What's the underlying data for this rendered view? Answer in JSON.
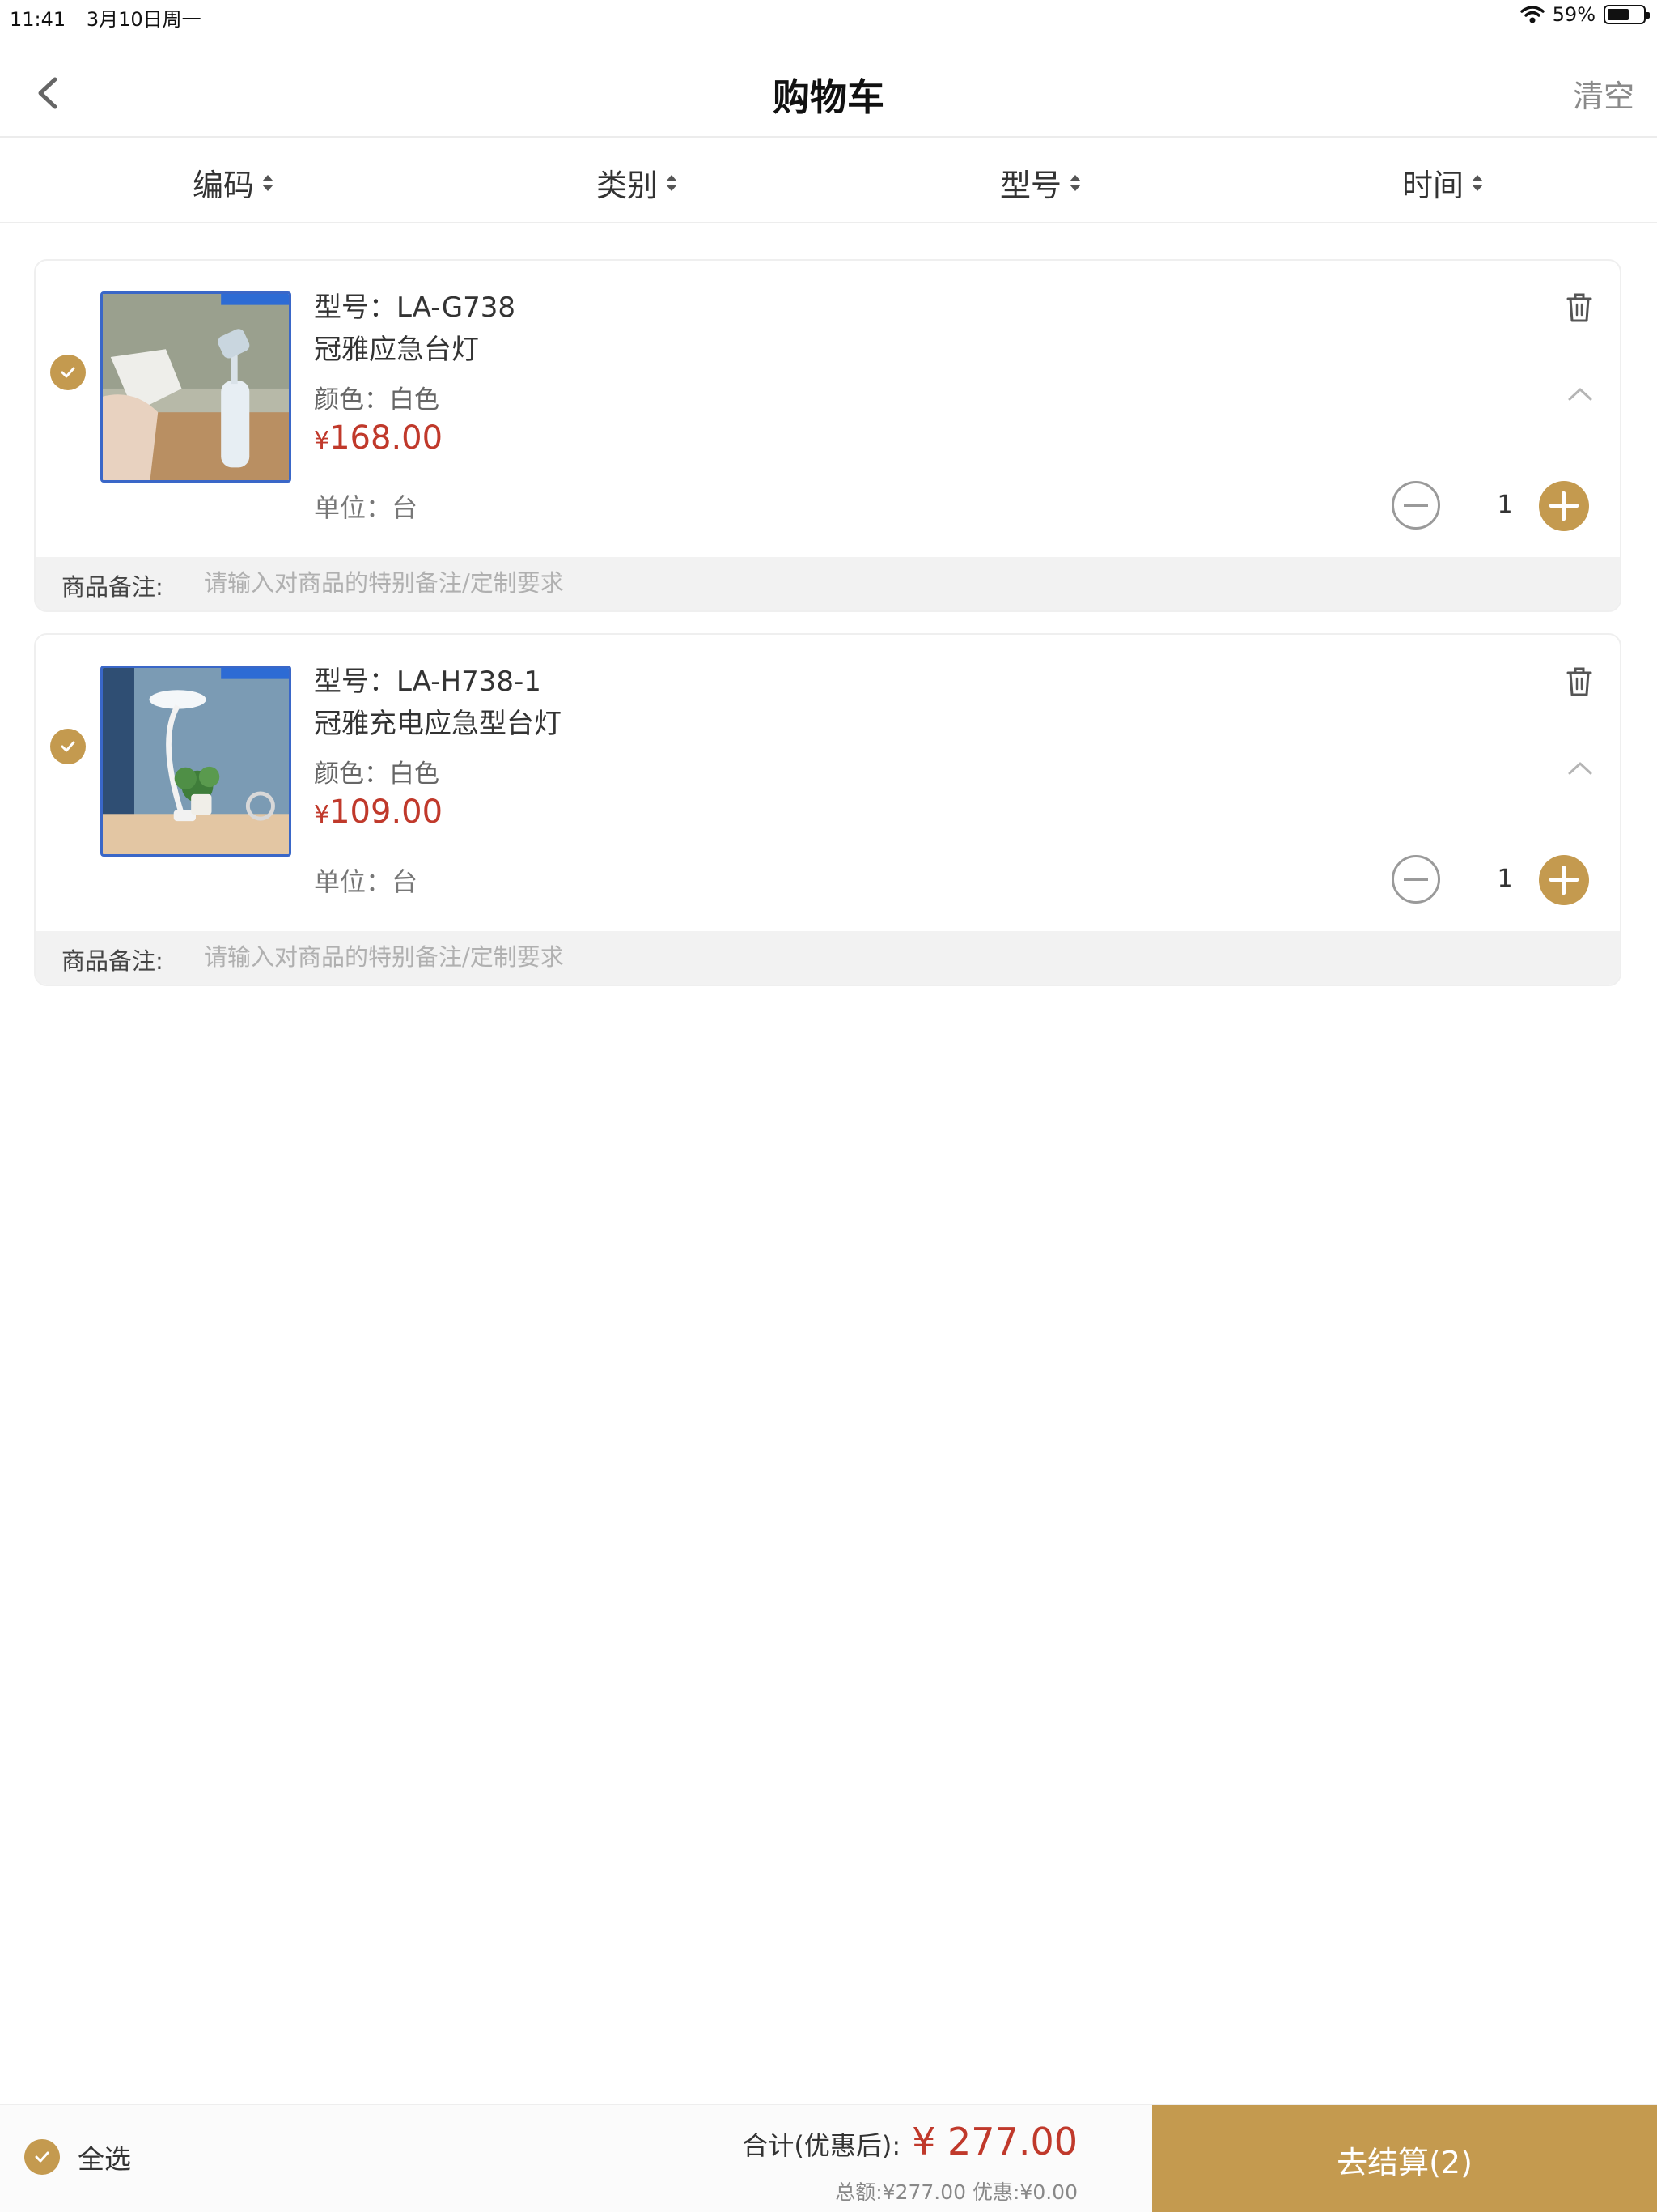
{
  "status_bar": {
    "time": "11:41",
    "date": "3月10日周一",
    "battery_percent": "59%",
    "battery_level": 0.59
  },
  "nav": {
    "title": "购物车",
    "clear_label": "清空"
  },
  "sort_tabs": [
    {
      "label": "编码"
    },
    {
      "label": "类别"
    },
    {
      "label": "型号"
    },
    {
      "label": "时间"
    }
  ],
  "cart_items": [
    {
      "model": "型号：LA-G738",
      "name": "冠雅应急台灯",
      "color": "颜色：白色",
      "currency": "¥",
      "price": "168.00",
      "unit": "单位：台",
      "quantity": "1",
      "note_label": "商品备注:",
      "note_placeholder": "请输入对商品的特别备注/定制要求",
      "checked": true
    },
    {
      "model": "型号：LA-H738-1",
      "name": "冠雅充电应急型台灯",
      "color": "颜色：白色",
      "currency": "¥",
      "price": "109.00",
      "unit": "单位：台",
      "quantity": "1",
      "note_label": "商品备注:",
      "note_placeholder": "请输入对商品的特别备注/定制要求",
      "checked": true
    }
  ],
  "footer": {
    "select_all_label": "全选",
    "total_label": "合计(优惠后):",
    "total_value": "¥ 277.00",
    "summary": "总额:¥277.00 优惠:¥0.00",
    "checkout_label": "去结算(2)"
  },
  "colors": {
    "accent": "#c49a4f",
    "price": "#c0392b",
    "thumb_border": "#3a67c8"
  },
  "icons": [
    "wifi-icon",
    "battery-icon",
    "back-arrow-icon",
    "sort-arrows-icon",
    "check-icon",
    "trash-icon",
    "chevron-up-icon",
    "minus-icon",
    "plus-icon"
  ]
}
